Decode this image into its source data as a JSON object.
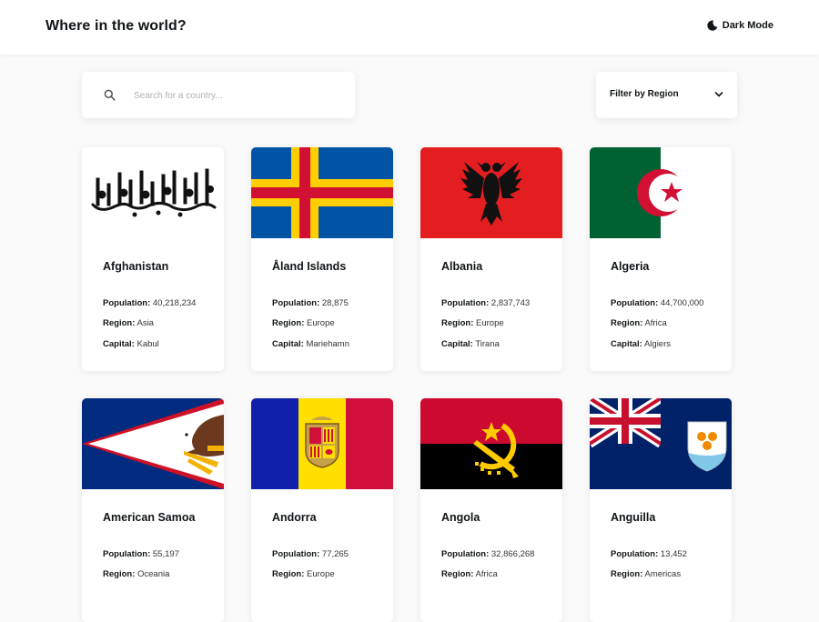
{
  "header": {
    "title": "Where in the world?",
    "mode_label": "Dark Mode",
    "mode_icon": "moon-icon"
  },
  "search": {
    "placeholder": "Search for a country...",
    "value": "",
    "icon": "search-icon"
  },
  "filter": {
    "label": "Filter by Region",
    "icon": "chevron-down-icon"
  },
  "field_labels": {
    "population": "Population:",
    "region": "Region:",
    "capital": "Capital:"
  },
  "countries": [
    {
      "name": "Afghanistan",
      "population": "40,218,234",
      "region": "Asia",
      "capital": "Kabul",
      "flag": "afghanistan-flag"
    },
    {
      "name": "Åland Islands",
      "population": "28,875",
      "region": "Europe",
      "capital": "Mariehamn",
      "flag": "aland-islands-flag"
    },
    {
      "name": "Albania",
      "population": "2,837,743",
      "region": "Europe",
      "capital": "Tirana",
      "flag": "albania-flag"
    },
    {
      "name": "Algeria",
      "population": "44,700,000",
      "region": "Africa",
      "capital": "Algiers",
      "flag": "algeria-flag"
    },
    {
      "name": "American Samoa",
      "population": "55,197",
      "region": "Oceania",
      "capital": "",
      "flag": "american-samoa-flag"
    },
    {
      "name": "Andorra",
      "population": "77,265",
      "region": "Europe",
      "capital": "",
      "flag": "andorra-flag"
    },
    {
      "name": "Angola",
      "population": "32,866,268",
      "region": "Africa",
      "capital": "",
      "flag": "angola-flag"
    },
    {
      "name": "Anguilla",
      "population": "13,452",
      "region": "Americas",
      "capital": "",
      "flag": "anguilla-flag"
    }
  ],
  "colors": {
    "background": "#fafafa",
    "surface": "#ffffff",
    "text": "#111517",
    "placeholder": "#b0b0b0"
  }
}
